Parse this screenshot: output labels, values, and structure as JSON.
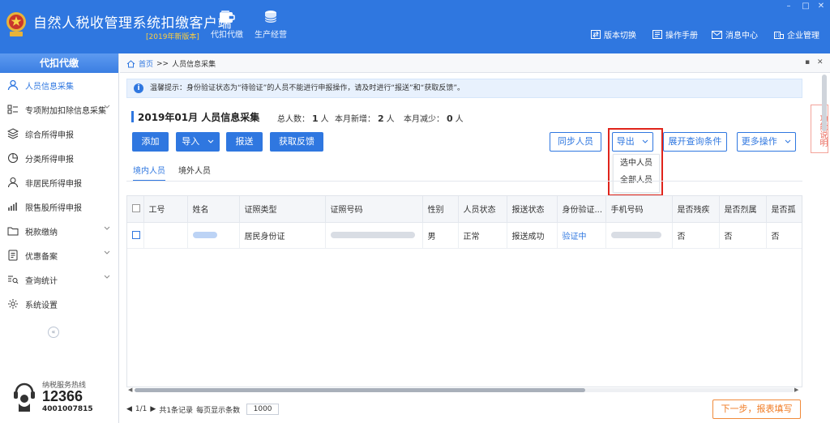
{
  "app": {
    "title": "自然人税收管理系统扣缴客户端",
    "subtitle": "[2019年新版本]",
    "nav": [
      {
        "label": "代扣代缴",
        "icon": "wallet-icon"
      },
      {
        "label": "生产经营",
        "icon": "coins-icon"
      }
    ],
    "header_links": [
      {
        "label": "版本切换",
        "icon": "switch-icon"
      },
      {
        "label": "操作手册",
        "icon": "manual-icon"
      },
      {
        "label": "消息中心",
        "icon": "mail-icon"
      },
      {
        "label": "企业管理",
        "icon": "building-icon"
      }
    ]
  },
  "sidebar": {
    "header": "代扣代缴",
    "items": [
      {
        "label": "人员信息采集",
        "icon": "person-icon",
        "active": true
      },
      {
        "label": "专项附加扣除信息采集",
        "icon": "list-icon"
      },
      {
        "label": "综合所得申报",
        "icon": "layers-icon"
      },
      {
        "label": "分类所得申报",
        "icon": "pie-icon"
      },
      {
        "label": "非居民所得申报",
        "icon": "person-icon"
      },
      {
        "label": "限售股所得申报",
        "icon": "bar-chart-icon"
      },
      {
        "label": "税款缴纳",
        "icon": "folder-icon"
      },
      {
        "label": "优惠备案",
        "icon": "document-icon"
      },
      {
        "label": "查询统计",
        "icon": "search-list-icon"
      },
      {
        "label": "系统设置",
        "icon": "gear-icon"
      }
    ],
    "collapse_icon": "«",
    "hotline": {
      "label": "纳税服务热线",
      "number": "12366",
      "number2": "4001007815"
    }
  },
  "breadcrumb": {
    "home": "首页",
    "separator": ">>",
    "current": "人员信息采集"
  },
  "notice": "温馨提示：身份验证状态为“待验证”的人员不能进行申报操作，请及时进行“报送”和“获取反馈”。",
  "side_tab": "功能说明",
  "page": {
    "title": "2019年01月  人员信息采集",
    "stats": [
      {
        "label": "总人数：",
        "value": "1",
        "unit": "人"
      },
      {
        "label": "本月新增：",
        "value": "2",
        "unit": "人"
      },
      {
        "label": "本月减少：",
        "value": "0",
        "unit": "人"
      }
    ]
  },
  "toolbar": {
    "add": "添加",
    "import": "导入",
    "submit": "报送",
    "feedback": "获取反馈",
    "sync": "同步人员",
    "export": "导出",
    "expand_query": "展开查询条件",
    "more": "更多操作"
  },
  "export_menu": [
    "选中人员",
    "全部人员"
  ],
  "subtabs": [
    "境内人员",
    "境外人员"
  ],
  "table": {
    "columns": [
      "工号",
      "姓名",
      "证照类型",
      "证照号码",
      "性别",
      "人员状态",
      "报送状态",
      "身份验证...",
      "手机号码",
      "是否残疾",
      "是否烈属",
      "是否孤"
    ],
    "rows": [
      {
        "id_type": "居民身份证",
        "gender": "男",
        "status": "正常",
        "submit_status": "报送成功",
        "verify": "验证中",
        "disabled": "否",
        "martyr": "否",
        "orphan": "否"
      }
    ]
  },
  "pager": {
    "page": "1/1",
    "records": "共1条记录",
    "page_size_label": "每页显示条数",
    "page_size": "1000"
  },
  "next_button": "下一步，报表填写"
}
